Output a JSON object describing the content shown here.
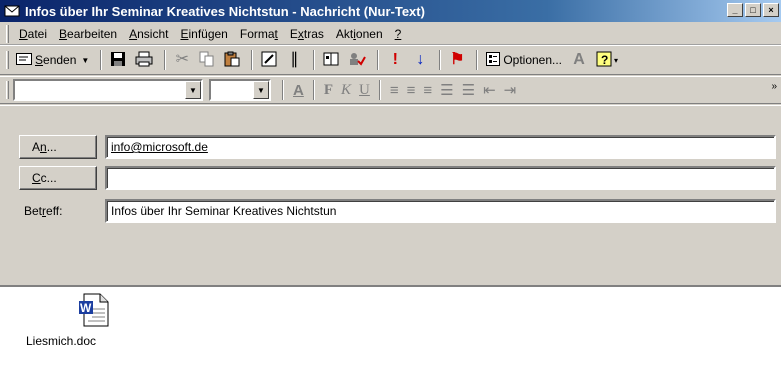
{
  "window": {
    "title": "Infos über Ihr Seminar Kreatives Nichtstun - Nachricht (Nur-Text)",
    "buttons": {
      "minimize": "_",
      "maximize": "□",
      "close": "×"
    }
  },
  "menu": {
    "items": [
      {
        "pre": "",
        "key": "D",
        "post": "atei"
      },
      {
        "pre": "",
        "key": "B",
        "post": "earbeiten"
      },
      {
        "pre": "",
        "key": "A",
        "post": "nsicht"
      },
      {
        "pre": "",
        "key": "E",
        "post": "infügen"
      },
      {
        "pre": "Forma",
        "key": "t",
        "post": ""
      },
      {
        "pre": "E",
        "key": "x",
        "post": "tras"
      },
      {
        "pre": "Akt",
        "key": "i",
        "post": "onen"
      },
      {
        "pre": "",
        "key": "?",
        "post": ""
      }
    ]
  },
  "toolbar": {
    "send_label": "Senden",
    "send_key": "S",
    "send_rest": "enden",
    "options_label": "Optionen...",
    "options_key": "p",
    "icons": [
      "envelope-icon",
      "save-icon",
      "print-icon",
      "cut-icon",
      "copy-icon",
      "paste-icon",
      "attach-file-icon",
      "paperclip-icon",
      "address-book-icon",
      "check-names-icon",
      "high-importance-icon",
      "low-importance-icon",
      "flag-icon",
      "options-icon",
      "font-size-icon",
      "help-icon"
    ]
  },
  "format_bar": {
    "font_name": "",
    "font_size": ""
  },
  "header": {
    "to_button": {
      "pre": "A",
      "key": "n",
      "post": "..."
    },
    "cc_button": {
      "pre": "",
      "key": "C",
      "post": "c..."
    },
    "subject_label": {
      "pre": "Bet",
      "key": "r",
      "post": "eff:"
    },
    "to_value": "info@microsoft.de",
    "cc_value": "",
    "subject_value": "Infos über Ihr Seminar Kreatives Nichtstun"
  },
  "body": {
    "attachment_name": "Liesmich.doc"
  }
}
